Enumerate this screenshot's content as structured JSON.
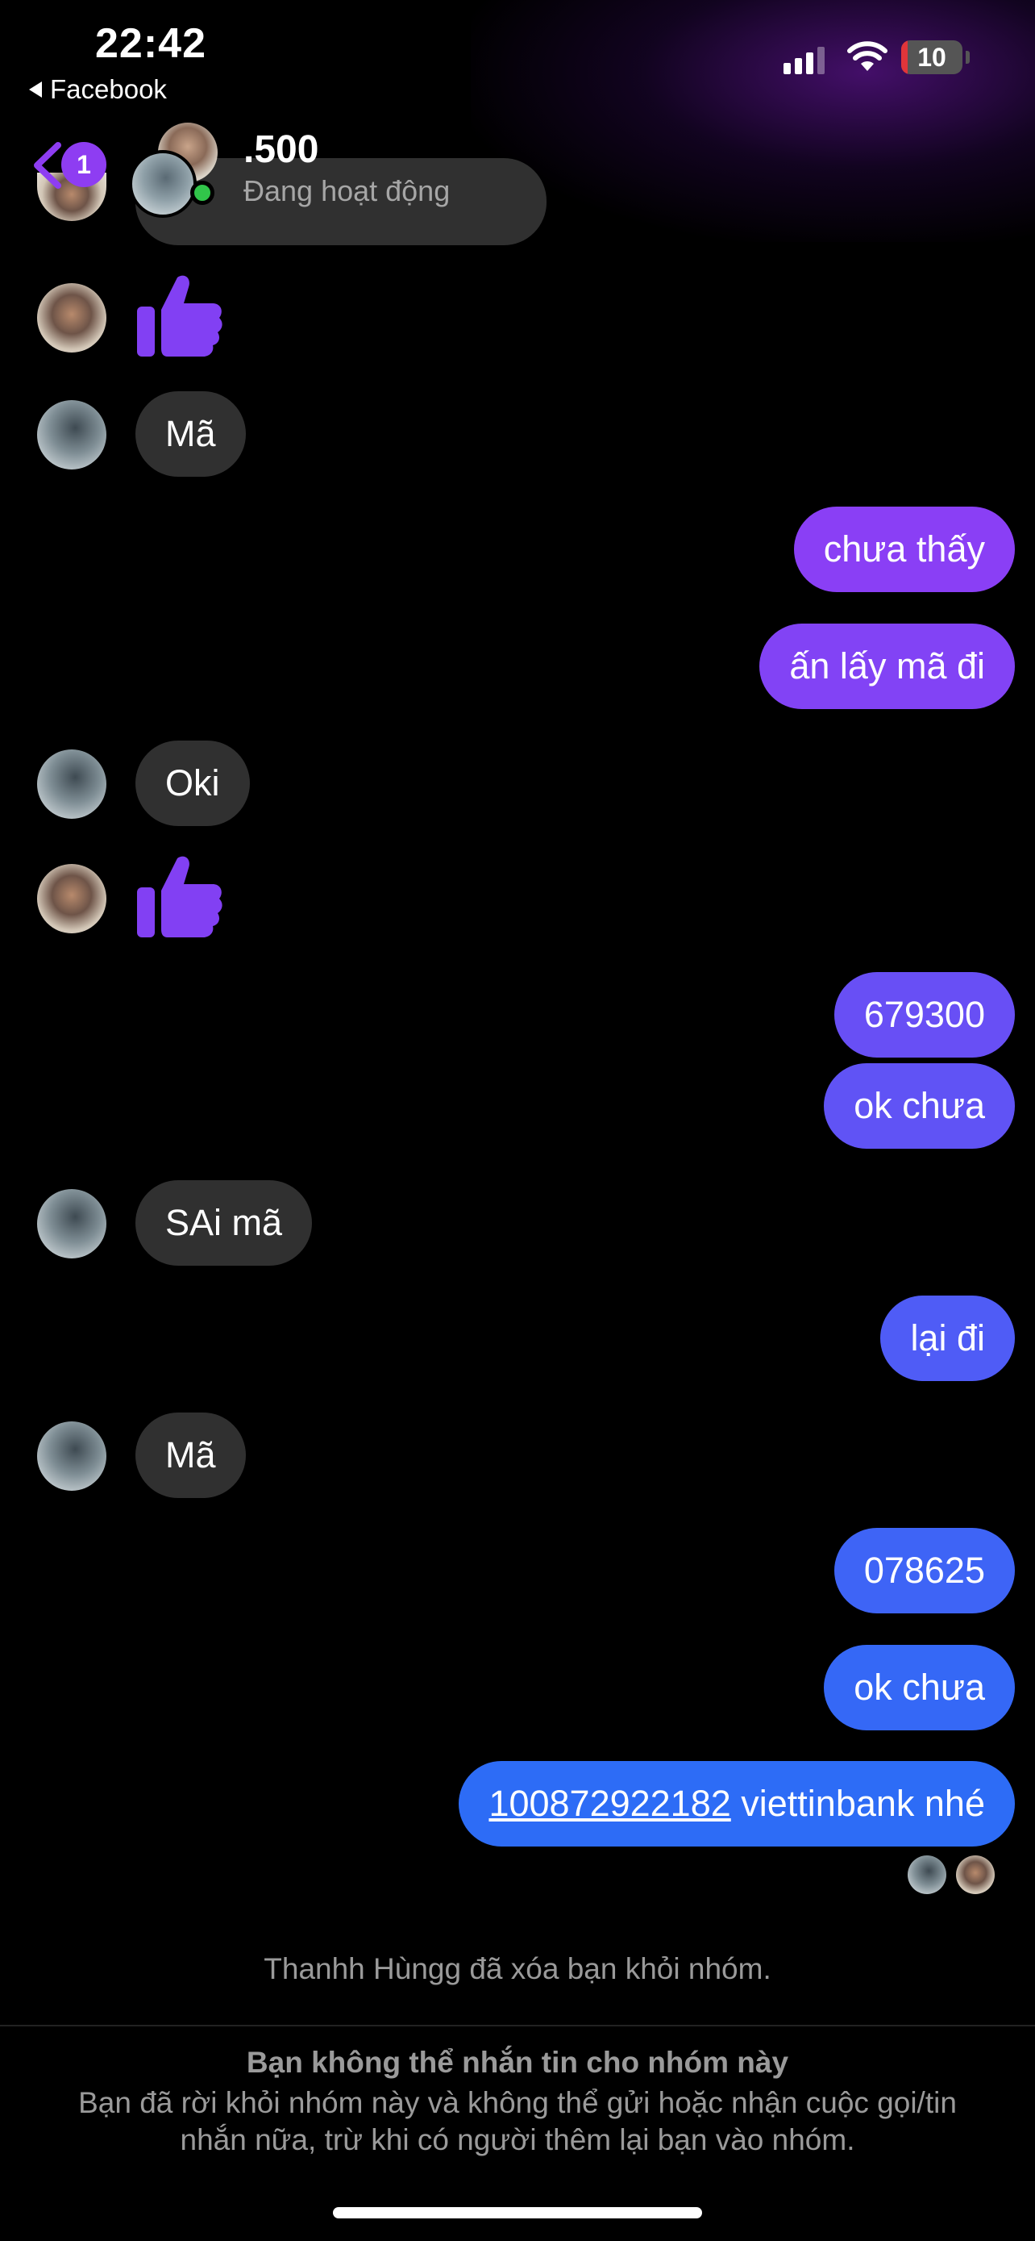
{
  "status_bar": {
    "time": "22:42",
    "back_app": "Facebook",
    "battery": "10",
    "battery_level": 0.1
  },
  "header": {
    "back_badge": "1",
    "chat_name": ".500",
    "chat_status": "Đang hoạt động"
  },
  "messages": [
    {
      "side": "in",
      "type": "like",
      "sender": "b"
    },
    {
      "side": "in",
      "type": "text",
      "text": "Mã",
      "sender": "a"
    },
    {
      "side": "out",
      "type": "text",
      "text": "chưa thấy"
    },
    {
      "side": "out",
      "type": "text",
      "text": "ấn lấy mã đi"
    },
    {
      "side": "in",
      "type": "text",
      "text": "Oki",
      "sender": "a"
    },
    {
      "side": "in",
      "type": "like",
      "sender": "b"
    },
    {
      "side": "out",
      "type": "text",
      "text": "679300"
    },
    {
      "side": "out",
      "type": "text",
      "text": "ok chưa"
    },
    {
      "side": "in",
      "type": "text",
      "text": "SAi mã",
      "sender": "a"
    },
    {
      "side": "out",
      "type": "text",
      "text": "lại đi"
    },
    {
      "side": "in",
      "type": "text",
      "text": "Mã",
      "sender": "a"
    },
    {
      "side": "out",
      "type": "text",
      "text": "078625"
    },
    {
      "side": "out",
      "type": "text",
      "text": "ok chưa"
    },
    {
      "side": "out",
      "type": "link",
      "link": "100872922182",
      "text": " viettinbank nhé"
    }
  ],
  "system_message": "Thanhh Hùngg đã xóa bạn khỏi nhóm.",
  "notice": {
    "title": "Bạn không thể nhắn tin cho nhóm này",
    "body": "Bạn đã rời khỏi nhóm này và không thể gửi hoặc nhận cuộc gọi/tin nhắn nữa, trừ khi có người thêm lại bạn vào nhóm."
  },
  "colors": {
    "incoming_bubble": "#303030",
    "outgoing_purple": "#8a3ff5",
    "outgoing_blue": "#2d6cf6",
    "like_icon": "#8240f3",
    "online": "#31c54a",
    "badge": "#8e3df2"
  }
}
